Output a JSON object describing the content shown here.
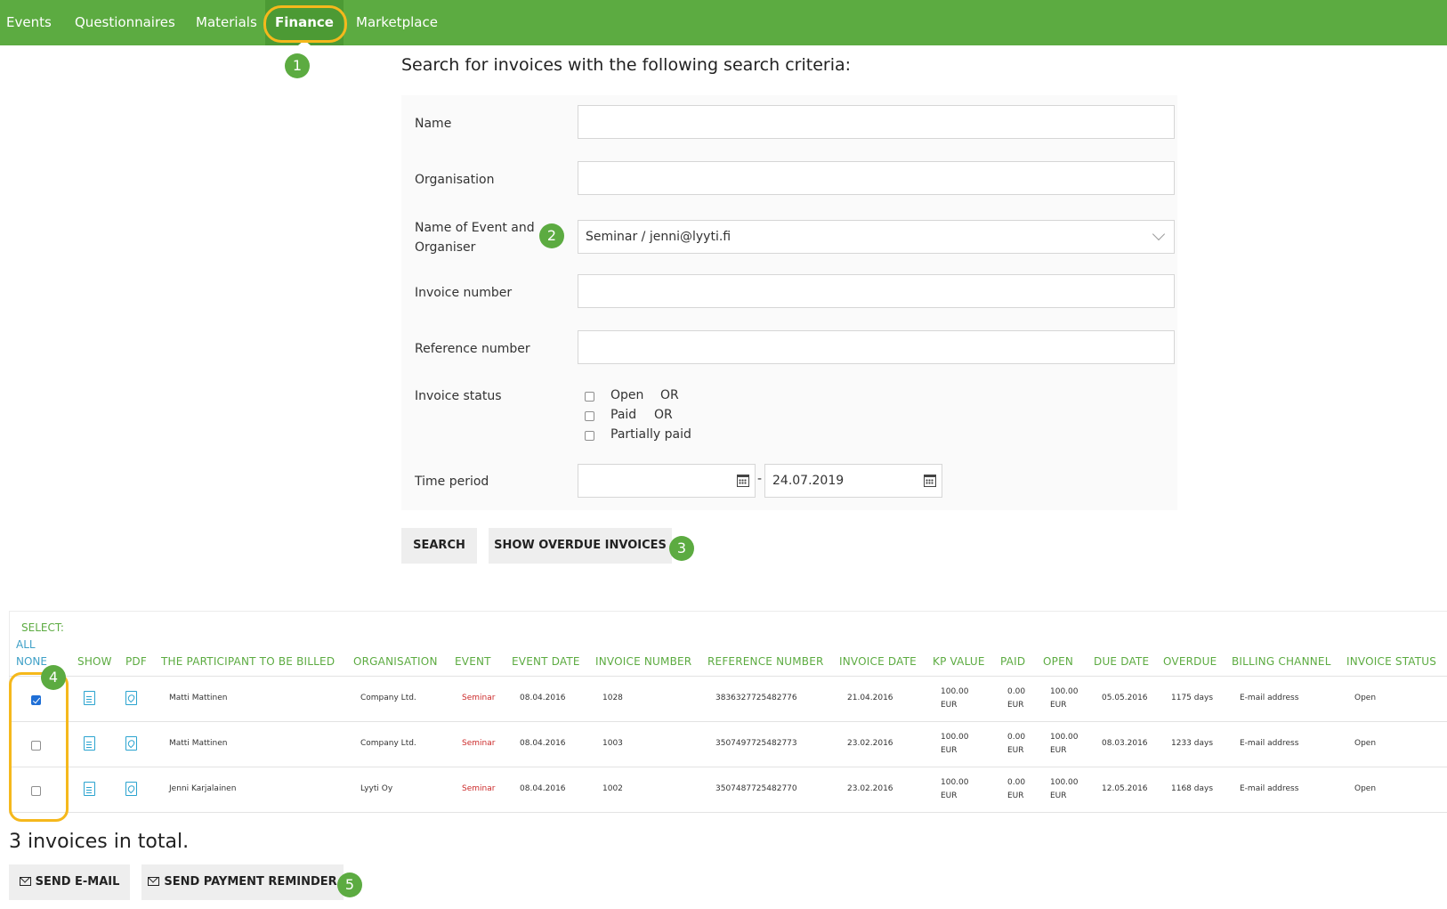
{
  "nav": {
    "items": [
      {
        "label": "Events"
      },
      {
        "label": "Questionnaires"
      },
      {
        "label": "Materials"
      },
      {
        "label": "Finance"
      },
      {
        "label": "Marketplace"
      }
    ]
  },
  "badges": [
    "1",
    "2",
    "3",
    "4",
    "5"
  ],
  "search": {
    "title": "Search for invoices with the following search criteria:",
    "name_label": "Name",
    "name_value": "",
    "organisation_label": "Organisation",
    "organisation_value": "",
    "event_label_line1": "Name of Event and",
    "event_label_line2": "Organiser",
    "event_value": "Seminar / jenni@lyyti.fi",
    "invoice_number_label": "Invoice number",
    "invoice_number_value": "",
    "reference_number_label": "Reference number",
    "reference_number_value": "",
    "invoice_status_label": "Invoice status",
    "status_options": [
      {
        "label": "Open",
        "suffix": "OR",
        "checked": false
      },
      {
        "label": "Paid",
        "suffix": "OR",
        "checked": false
      },
      {
        "label": "Partially paid",
        "suffix": "",
        "checked": false
      }
    ],
    "time_period_label": "Time period",
    "date_from": "",
    "date_separator": "-",
    "date_to": "24.07.2019",
    "search_button": "SEARCH",
    "overdue_button": "SHOW OVERDUE INVOICES"
  },
  "table": {
    "select_label": "SELECT:",
    "select_all": "ALL",
    "select_none": "NONE",
    "headers": {
      "show": "SHOW",
      "pdf": "PDF",
      "participant": "THE PARTICIPANT TO BE BILLED",
      "organisation": "ORGANISATION",
      "event": "EVENT",
      "event_date": "EVENT DATE",
      "invoice_number": "INVOICE NUMBER",
      "reference_number": "REFERENCE NUMBER",
      "invoice_date": "INVOICE DATE",
      "kp_value": "KP VALUE",
      "paid": "PAID",
      "open": "OPEN",
      "due_date": "DUE DATE",
      "overdue": "OVERDUE",
      "billing_channel": "BILLING CHANNEL",
      "invoice_status": "INVOICE STATUS"
    },
    "rows": [
      {
        "selected": true,
        "participant": "Matti Mattinen",
        "organisation": "Company Ltd.",
        "event": "Seminar",
        "event_date": "08.04.2016",
        "invoice_number": "1028",
        "reference_number": "3836327725482776",
        "invoice_date": "21.04.2016",
        "kp_value": "100.00",
        "paid": "0.00",
        "open": "100.00",
        "currency": "EUR",
        "due_date": "05.05.2016",
        "overdue": "1175 days",
        "billing_channel": "E-mail address",
        "status": "Open"
      },
      {
        "selected": false,
        "participant": "Matti Mattinen",
        "organisation": "Company Ltd.",
        "event": "Seminar",
        "event_date": "08.04.2016",
        "invoice_number": "1003",
        "reference_number": "3507497725482773",
        "invoice_date": "23.02.2016",
        "kp_value": "100.00",
        "paid": "0.00",
        "open": "100.00",
        "currency": "EUR",
        "due_date": "08.03.2016",
        "overdue": "1233 days",
        "billing_channel": "E-mail address",
        "status": "Open"
      },
      {
        "selected": false,
        "participant": "Jenni Karjalainen",
        "organisation": "Lyyti Oy",
        "event": "Seminar",
        "event_date": "08.04.2016",
        "invoice_number": "1002",
        "reference_number": "3507487725482770",
        "invoice_date": "23.02.2016",
        "kp_value": "100.00",
        "paid": "0.00",
        "open": "100.00",
        "currency": "EUR",
        "due_date": "12.05.2016",
        "overdue": "1168 days",
        "billing_channel": "E-mail address",
        "status": "Open"
      }
    ]
  },
  "footer": {
    "total": "3 invoices in total.",
    "send_email_button": "SEND E-MAIL",
    "send_reminder_button": "SEND PAYMENT REMINDER"
  },
  "colors": {
    "nav_green": "#5cab41",
    "nav_active": "#4c9a34",
    "highlight": "#f5b81c",
    "header_text": "#5cab41",
    "link": "#3ea0c7",
    "event_red": "#cc2a2a"
  }
}
